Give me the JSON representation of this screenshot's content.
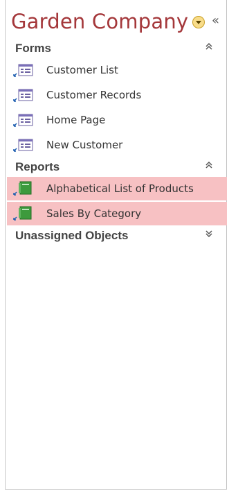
{
  "header": {
    "title": "Garden Company",
    "menu_icon": "dropdown-circle-icon",
    "collapse_icon": "double-chevron-left-icon",
    "collapse_glyph": "«"
  },
  "groups": [
    {
      "label": "Forms",
      "chevron": "˄",
      "items": [
        {
          "label": "Customer List",
          "icon": "form-icon"
        },
        {
          "label": "Customer Records",
          "icon": "form-icon"
        },
        {
          "label": "Home Page",
          "icon": "form-icon"
        },
        {
          "label": "New Customer",
          "icon": "form-icon"
        }
      ]
    },
    {
      "label": "Reports",
      "chevron": "˄",
      "items": [
        {
          "label": "Alphabetical List of Products",
          "icon": "report-icon",
          "selected": true
        },
        {
          "label": "Sales By Category",
          "icon": "report-icon",
          "selected": true
        }
      ]
    },
    {
      "label": "Unassigned Objects",
      "chevron": "˅",
      "items": []
    }
  ],
  "colors": {
    "title": "#a4373a",
    "selected_bg": "#f7c1c3"
  }
}
